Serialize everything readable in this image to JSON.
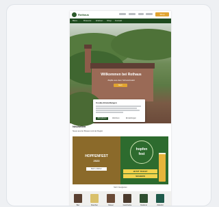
{
  "header": {
    "logo_text": "Rothaus",
    "cta_label": "Shop"
  },
  "nav": {
    "items": [
      "Biere",
      "Brauerei",
      "Erleben",
      "Shop",
      "Kontakt"
    ]
  },
  "hero": {
    "title": "Willkommen bei Rothaus",
    "subtitle": "Zäpfle aus dem Schwarzwald",
    "button_label": "Mehr"
  },
  "cookie_dialog": {
    "title": "Cookie-Einstellungen",
    "accept_label": "Akzeptieren",
    "deny_label": "Ablehnen",
    "settings_label": "Einstellungen"
  },
  "section": {
    "title": "Neuheiten",
    "subtitle": "Neues aus der Brauerei und der Region"
  },
  "banners": {
    "left": {
      "title": "HOPFENFEST",
      "year": "2023",
      "button_label": "Mehr erfahren"
    },
    "right": {
      "line_top": "hopfen",
      "line_bottom": "fest",
      "ticket_line1": "JETZT TICKET",
      "ticket_line2": "SICHERN"
    }
  },
  "more_link": "Mehr Neuigkeiten",
  "categories": [
    {
      "label": "Bier"
    },
    {
      "label": "Flaschen"
    },
    {
      "label": "Fässer"
    },
    {
      "label": "Geschenke"
    },
    {
      "label": "Kleidung"
    },
    {
      "label": "Zubehör"
    }
  ],
  "colors": {
    "brand_green": "#1f4b1f",
    "accent_orange": "#e1a430",
    "ticket_yellow": "#f2d34c"
  }
}
